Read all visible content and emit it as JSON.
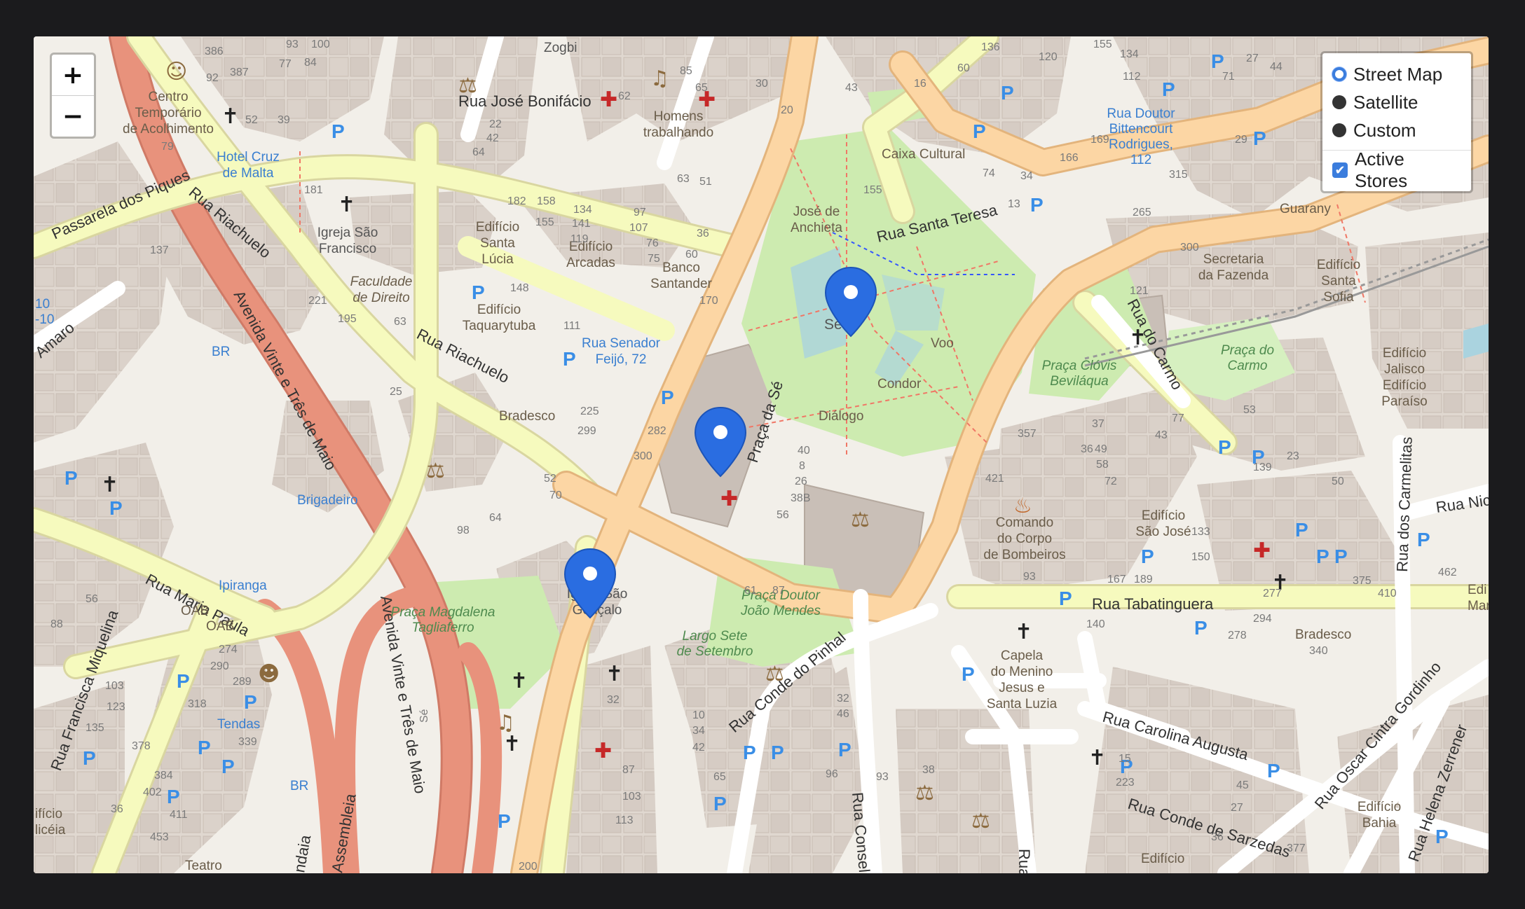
{
  "controls": {
    "zoom_in": "+",
    "zoom_out": "−"
  },
  "layers": {
    "base": [
      {
        "label": "Street Map",
        "selected": true
      },
      {
        "label": "Satellite",
        "selected": false
      },
      {
        "label": "Custom",
        "selected": false
      }
    ],
    "overlays": [
      {
        "label": "Active Stores",
        "checked": true
      }
    ]
  },
  "markers": [
    {
      "id": "store-1",
      "color": "#2a6de1"
    },
    {
      "id": "store-2",
      "color": "#2a6de1"
    },
    {
      "id": "store-3",
      "color": "#2a6de1"
    }
  ],
  "streets": {
    "rua_jose_bonifacio": "Rua José Bonifácio",
    "passarela_dos_piques": "Passarela dos Piques",
    "rua_riachuelo": "Rua Riachuelo",
    "rua_riachuelo_2": "Rua Riachuelo",
    "avenida_vinte_tres_maio": "Avenida Vinte e Três de Maio",
    "avenida_vinte_tres_maio_2": "Avenida Vinte e Três de Maio",
    "rua_santa_teresa": "Rua Santa Teresa",
    "rua_do_carmo": "Rua do Carmo",
    "rua_maria_paula": "Rua Maria Paula",
    "rua_francisca_miquelina": "Rua Francisca Miquelina",
    "rua_tabatinguera": "Rua Tabatinguera",
    "rua_conde_do_pinhal": "Rua Conde do Pinhal",
    "rua_carolina_augusta": "Rua Carolina Augusta",
    "rua_conde_de_sarzedas": "Rua Conde de Sarzedas",
    "rua_oscar_cintra_gordinho": "Rua Oscar Cintra Gordinho",
    "rua_helena_zerrener": "Rua Helena Zerrener",
    "rua_dos_carmelitas": "Rua dos Carmelitas",
    "praca_da_se": "Praça da Sé",
    "amaro": "Amaro",
    "rua_nic": "Rua Nic",
    "assembleia": "Assembleia",
    "dalaia": "ndaia",
    "rua_consel": "Rua Consel",
    "rua_right": "Rua",
    "se_street": "Sé"
  },
  "places": {
    "centro_temporario": [
      "Centro",
      "Temporário",
      "de Acolhimento"
    ],
    "hotel_cruz": [
      "Hotel Cruz",
      "de Malta"
    ],
    "igreja_sao_francisco": [
      "Igreja São",
      "Francisco"
    ],
    "faculdade": [
      "Faculdade",
      "de Direito"
    ],
    "edificio_santa_lucia": [
      "Edifício",
      "Santa",
      "Lúcia"
    ],
    "edificio_arcadas": [
      "Edifício",
      "Arcadas"
    ],
    "banco_santander": [
      "Banco",
      "Santander"
    ],
    "edificio_taquarytuba": [
      "Edifício",
      "Taquarytuba"
    ],
    "rua_senador_feijo": [
      "Rua Senador",
      "Feijó, 72"
    ],
    "bradesco_1": "Bradesco",
    "brigadeiro": "Brigadeiro",
    "homens_trabalhando": [
      "Homens",
      "trabalhando"
    ],
    "caixa_cultural": "Caixa Cultural",
    "jose_anchieta": [
      "José de",
      "Anchieta"
    ],
    "se": "Sé",
    "voo": "Voo",
    "condor": "Condor",
    "dialogo": "Diálogo",
    "zogbi": "Zogbi",
    "rua_doutor_bittencourt": [
      "Rua Doutor",
      "Bittencourt",
      "Rodrigues,",
      "112"
    ],
    "guarany": "Guarany",
    "secretaria_fazenda": [
      "Secretaria",
      "da Fazenda"
    ],
    "edificio_santa_sofia": [
      "Edifício",
      "Santa",
      "Sofia"
    ],
    "praca_do_carmo": [
      "Praça do",
      "Carmo"
    ],
    "praca_clovis": [
      "Praça Clóvis",
      "Beviláqua"
    ],
    "edificio_jalisco": [
      "Edifício",
      "Jalisco"
    ],
    "edificio_paraiso": [
      "Edifício",
      "Paraíso"
    ],
    "comando_bombeiros": [
      "Comando",
      "do Corpo",
      "de Bombeiros"
    ],
    "edificio_sao_jose": [
      "Edifício",
      "São José"
    ],
    "igreja_sao_goncalo": [
      "Igreja São",
      "Gonçalo"
    ],
    "praca_magdalena": [
      "Praça Magdalena",
      "Tagliaferro"
    ],
    "praca_joao_mendes": [
      "Praça Doutor",
      "João Mendes"
    ],
    "largo_sete": [
      "Largo Sete",
      "de Setembro"
    ],
    "capela": [
      "Capela",
      "do Menino",
      "Jesus e",
      "Santa Luzia"
    ],
    "bradesco_2": "Bradesco",
    "ipiranga": "Ipiranga",
    "oab_1": "OAB",
    "oab_2": "OAB",
    "tendas": "Tendas",
    "br_1": "BR",
    "br_2": "BR",
    "edificio_bahia": [
      "Edifício",
      "Bahia"
    ],
    "edificio_bottom": "Edifício",
    "teatro": "Teatro",
    "edificio_left": [
      "ifício",
      "licéia"
    ],
    "edi_right": [
      "Edi",
      "Marc"
    ],
    "left_10": [
      "10",
      "-10"
    ]
  },
  "house_numbers": [
    "386",
    "93",
    "100",
    "387",
    "92",
    "77",
    "84",
    "52",
    "39",
    "79",
    "181",
    "182",
    "158",
    "155",
    "134",
    "141",
    "119",
    "107",
    "97",
    "63",
    "51",
    "76",
    "75",
    "60",
    "36",
    "170",
    "148",
    "111",
    "22",
    "42",
    "64",
    "65",
    "62",
    "85",
    "20",
    "43",
    "30",
    "136",
    "16",
    "60",
    "155",
    "134",
    "120",
    "112",
    "27",
    "44",
    "71",
    "169",
    "166",
    "74",
    "34",
    "315",
    "29",
    "265",
    "13",
    "155",
    "300",
    "121",
    "137",
    "221",
    "195",
    "63",
    "25",
    "52",
    "299",
    "282",
    "300",
    "225",
    "70",
    "98",
    "64",
    "40",
    "8",
    "26",
    "38B",
    "56",
    "357",
    "37",
    "36",
    "49",
    "58",
    "72",
    "43",
    "77",
    "53",
    "421",
    "139",
    "23",
    "50",
    "133",
    "150",
    "277",
    "294",
    "462",
    "410",
    "167",
    "189",
    "375",
    "56",
    "88",
    "274",
    "290",
    "289",
    "318",
    "339",
    "378",
    "384",
    "402",
    "411",
    "453",
    "36",
    "103",
    "123",
    "135",
    "103",
    "113",
    "87",
    "200",
    "32",
    "10",
    "34",
    "42",
    "65",
    "61",
    "87",
    "93",
    "140",
    "96",
    "93",
    "38",
    "32",
    "46",
    "15",
    "223",
    "45",
    "27",
    "36",
    "377",
    "340",
    "278"
  ],
  "colors": {
    "land": "#f2efe9",
    "building": "#d9d0c9",
    "park": "#cdebb0",
    "primary_road": "#f9d5a2",
    "secondary_road": "#f6fabe",
    "trunk_road": "#e8927c",
    "water": "#aad3df",
    "parking_blue": "#3a8ee6",
    "marker_blue": "#2a6de1"
  }
}
